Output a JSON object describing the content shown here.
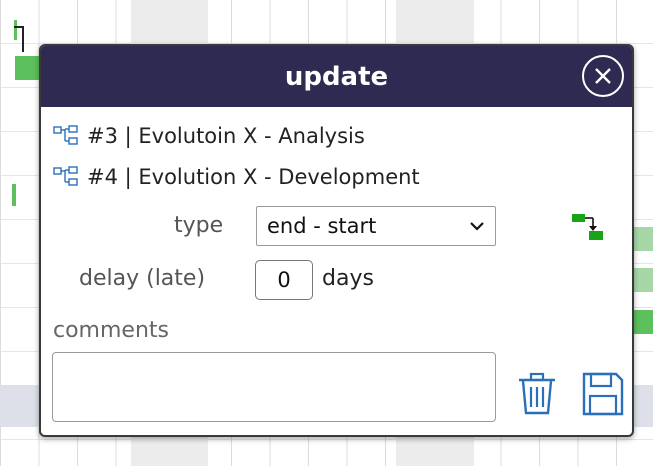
{
  "dialog": {
    "title": "update",
    "tasks": [
      {
        "label": "#3 | Evolutoin X - Analysis"
      },
      {
        "label": "#4 | Evolution X - Development"
      }
    ],
    "type_label": "type",
    "type_value": "end - start",
    "delay_label": "delay (late)",
    "delay_value": "0",
    "delay_unit": "days",
    "comments_label": "comments",
    "comments_value": ""
  },
  "icons": {
    "close": "close-circle-icon",
    "task": "task-hierarchy-icon",
    "dependency": "end-start-dependency-icon",
    "delete": "trash-icon",
    "save": "floppy-disk-icon"
  },
  "colors": {
    "header_bg": "#2e2a52",
    "gantt_bar": "#5cc05c",
    "icon_blue": "#2a6fba"
  }
}
